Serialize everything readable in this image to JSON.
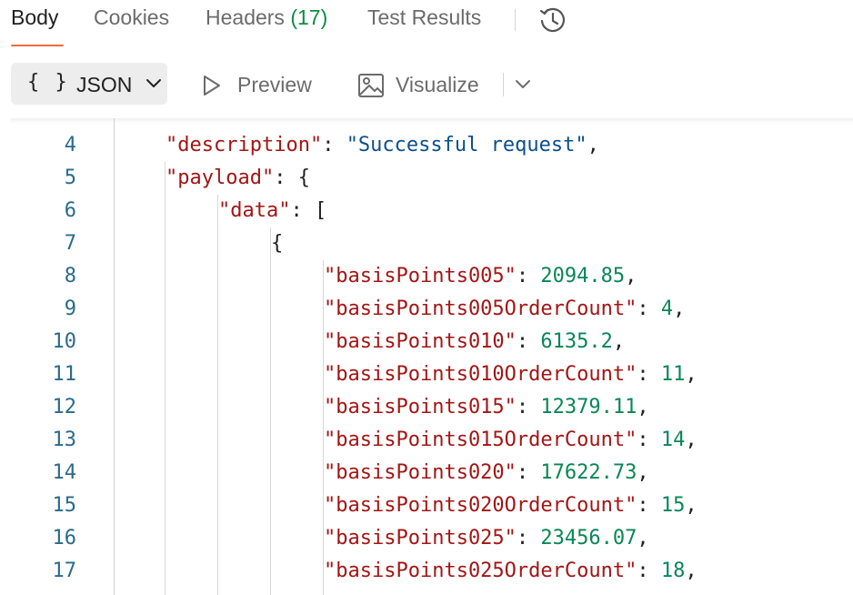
{
  "tabs": {
    "body": "Body",
    "cookies": "Cookies",
    "headers_label": "Headers",
    "headers_count": "(17)",
    "test_results": "Test Results"
  },
  "toolbar": {
    "format_braces": "{ }",
    "format_label": "JSON",
    "preview_label": "Preview",
    "visualize_label": "Visualize"
  },
  "icons": {
    "history": "history-icon",
    "format_chevron": "chevron-down-icon",
    "preview": "play-icon",
    "visualize": "image-icon",
    "more": "chevron-down-icon"
  },
  "colors": {
    "accent": "#f26b3a",
    "key": "#a31515",
    "string": "#0b4f8a",
    "number": "#098658",
    "line_number": "#2a6a8c",
    "count": "#0a8f3c"
  },
  "editor": {
    "lines": [
      {
        "num": "4",
        "indent": 1,
        "key": "\"description\"",
        "value": "\"Successful request\"",
        "value_type": "string",
        "suffix": ","
      },
      {
        "num": "5",
        "indent": 1,
        "key": "\"payload\"",
        "value": "{",
        "value_type": "punc",
        "suffix": ""
      },
      {
        "num": "6",
        "indent": 2,
        "key": "\"data\"",
        "value": "[",
        "value_type": "punc",
        "suffix": ""
      },
      {
        "num": "7",
        "indent": 3,
        "key": "",
        "value": "{",
        "value_type": "punc",
        "suffix": ""
      },
      {
        "num": "8",
        "indent": 4,
        "key": "\"basisPoints005\"",
        "value": "2094.85",
        "value_type": "number",
        "suffix": ","
      },
      {
        "num": "9",
        "indent": 4,
        "key": "\"basisPoints005OrderCount\"",
        "value": "4",
        "value_type": "number",
        "suffix": ","
      },
      {
        "num": "10",
        "indent": 4,
        "key": "\"basisPoints010\"",
        "value": "6135.2",
        "value_type": "number",
        "suffix": ","
      },
      {
        "num": "11",
        "indent": 4,
        "key": "\"basisPoints010OrderCount\"",
        "value": "11",
        "value_type": "number",
        "suffix": ","
      },
      {
        "num": "12",
        "indent": 4,
        "key": "\"basisPoints015\"",
        "value": "12379.11",
        "value_type": "number",
        "suffix": ","
      },
      {
        "num": "13",
        "indent": 4,
        "key": "\"basisPoints015OrderCount\"",
        "value": "14",
        "value_type": "number",
        "suffix": ","
      },
      {
        "num": "14",
        "indent": 4,
        "key": "\"basisPoints020\"",
        "value": "17622.73",
        "value_type": "number",
        "suffix": ","
      },
      {
        "num": "15",
        "indent": 4,
        "key": "\"basisPoints020OrderCount\"",
        "value": "15",
        "value_type": "number",
        "suffix": ","
      },
      {
        "num": "16",
        "indent": 4,
        "key": "\"basisPoints025\"",
        "value": "23456.07",
        "value_type": "number",
        "suffix": ","
      },
      {
        "num": "17",
        "indent": 4,
        "key": "\"basisPoints025OrderCount\"",
        "value": "18",
        "value_type": "number",
        "suffix": ","
      }
    ]
  }
}
